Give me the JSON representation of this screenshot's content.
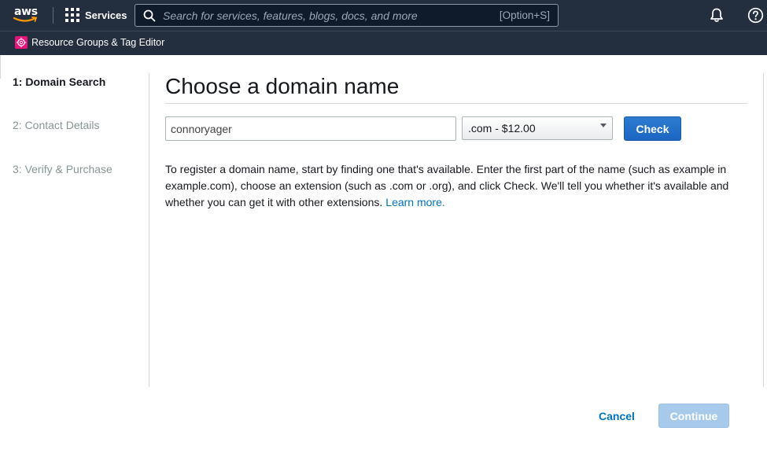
{
  "topnav": {
    "logo_text": "aws",
    "logo_icon": "aws-smile-icon",
    "services_label": "Services",
    "services_icon": "grid-icon",
    "search": {
      "placeholder": "Search for services, features, blogs, docs, and more",
      "shortcut": "[Option+S]",
      "icon": "search-icon"
    },
    "notifications_icon": "bell-icon",
    "help_icon": "help-icon"
  },
  "subnav": {
    "service_icon": "resource-groups-icon",
    "service_label": "Resource Groups & Tag Editor"
  },
  "steps": [
    {
      "label": "1: Domain Search",
      "active": true
    },
    {
      "label": "2: Contact Details",
      "active": false
    },
    {
      "label": "3: Verify & Purchase",
      "active": false
    }
  ],
  "main": {
    "title": "Choose a domain name",
    "domain_input": {
      "value": "connoryager",
      "placeholder": ""
    },
    "tld_select": {
      "value": ".com - $12.00"
    },
    "check_label": "Check",
    "description": "To register a domain name, start by finding one that's available. Enter the first part of the name (such as example in example.com), choose an extension (such as .com or .org), and click Check. We'll tell you whether it's available and whether you can get it with other extensions.",
    "learn_more": "Learn more."
  },
  "footer": {
    "cancel_label": "Cancel",
    "continue_label": "Continue"
  },
  "colors": {
    "nav_background": "#232f3e",
    "primary_button": "#1a66c2",
    "link": "#0073bb",
    "disabled_button": "#a7c9ea",
    "resource_groups_icon": "#e7157b"
  }
}
